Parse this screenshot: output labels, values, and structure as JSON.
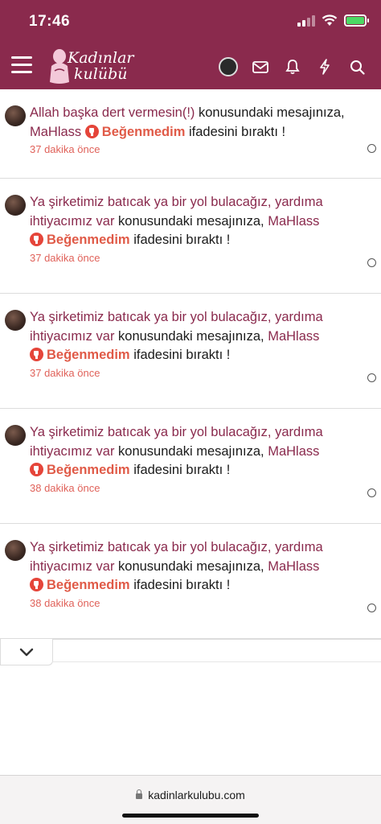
{
  "status_bar": {
    "time": "17:46"
  },
  "header": {
    "logo_line1": "Kadınlar",
    "logo_line2": "kulübü",
    "icons": [
      "menu-icon",
      "avatar",
      "mail-icon",
      "bell-icon",
      "lightning-icon",
      "search-icon"
    ]
  },
  "notifications": [
    {
      "thread": "Allah başka dert vermesin(!)",
      "mid": " konusundaki mesajınıza, ",
      "user": "MaHlass",
      "reaction": "Beğenmedim",
      "tail": " ifadesini bıraktı !",
      "time": "37 dakika önce"
    },
    {
      "thread": "Ya şirketimiz batıcak ya bir yol bulacağız, yardıma ihtiyacımız var",
      "mid": " konusundaki mesajınıza, ",
      "user": "MaHlass",
      "reaction": "Beğenmedim",
      "tail": " ifadesini bıraktı !",
      "time": "37 dakika önce"
    },
    {
      "thread": "Ya şirketimiz batıcak ya bir yol bulacağız, yardıma ihtiyacımız var",
      "mid": " konusundaki mesajınıza, ",
      "user": "MaHlass",
      "reaction": "Beğenmedim",
      "tail": " ifadesini bıraktı !",
      "time": "37 dakika önce"
    },
    {
      "thread": "Ya şirketimiz batıcak ya bir yol bulacağız, yardıma ihtiyacımız var",
      "mid": " konusundaki mesajınıza, ",
      "user": "MaHlass",
      "reaction": "Beğenmedim",
      "tail": " ifadesini bıraktı !",
      "time": "38 dakika önce"
    },
    {
      "thread": "Ya şirketimiz batıcak ya bir yol bulacağız, yardıma ihtiyacımız var",
      "mid": " konusundaki mesajınıza, ",
      "user": "MaHlass",
      "reaction": "Beğenmedim",
      "tail": " ifadesini bıraktı !",
      "time": "38 dakika önce"
    }
  ],
  "browser": {
    "url": "kadinlarkulubu.com"
  },
  "colors": {
    "brand": "#8a2a4d",
    "reaction": "#e05a47"
  }
}
